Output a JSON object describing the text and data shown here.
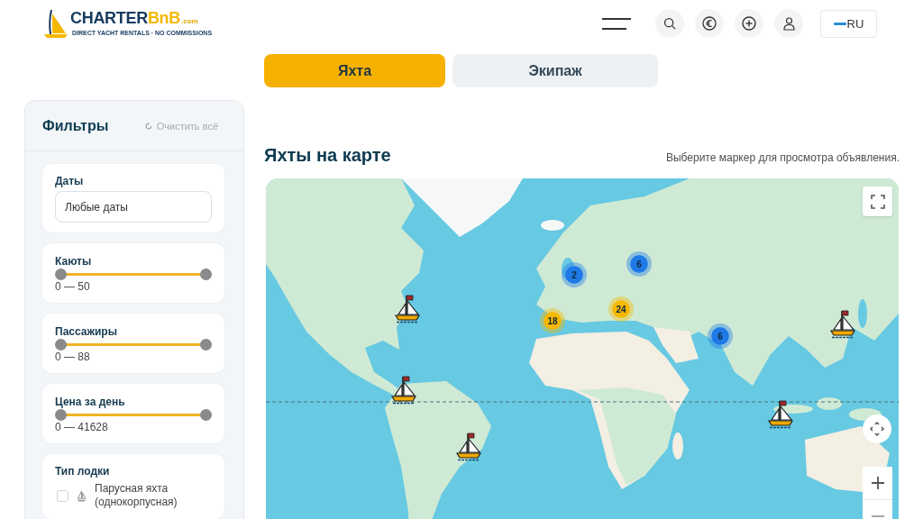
{
  "header": {
    "logo": {
      "word": "CHARTER",
      "accent": "BnB",
      "suffix": ".com",
      "tagline": "DIRECT YACHT RENTALS · NO COMMISSIONS"
    },
    "language": {
      "label": "RU"
    }
  },
  "tabs": [
    {
      "label": "Яхта",
      "selected": true
    },
    {
      "label": "Экипаж",
      "selected": false
    }
  ],
  "filters": {
    "title": "Фильтры",
    "clear": "Очистить всё",
    "sections": [
      {
        "kind": "field",
        "label": "Даты",
        "value": "Любые даты"
      },
      {
        "kind": "range",
        "label": "Каюты",
        "thumbs": [
          {
            "level": 0
          },
          {
            "level": 1
          }
        ],
        "reading": "0 — 50"
      },
      {
        "kind": "range",
        "label": "Пассажиры",
        "thumbs": [
          {
            "level": 0
          },
          {
            "level": 1
          }
        ],
        "reading": "0 — 88"
      },
      {
        "kind": "range",
        "label": "Цена за день",
        "thumbs": [
          {
            "level": 0
          },
          {
            "level": 1
          }
        ],
        "reading": "0 — 41628"
      },
      {
        "kind": "checklist",
        "label": "Тип лодки",
        "options": [
          {
            "label": "Парусная яхта (однокорпусная)",
            "checked": false
          }
        ]
      }
    ]
  },
  "main": {
    "title": "Яхты на карте",
    "hint": "Выберите маркер для просмотра объявления.",
    "map": {
      "clusters": [
        {
          "count": "2",
          "color": "#1f7ae8"
        },
        {
          "count": "6",
          "color": "#1f7ae8"
        },
        {
          "count": "24",
          "color": "#f5b800"
        },
        {
          "count": "18",
          "color": "#f5b800"
        },
        {
          "count": "6",
          "color": "#1f7ae8"
        }
      ]
    }
  }
}
